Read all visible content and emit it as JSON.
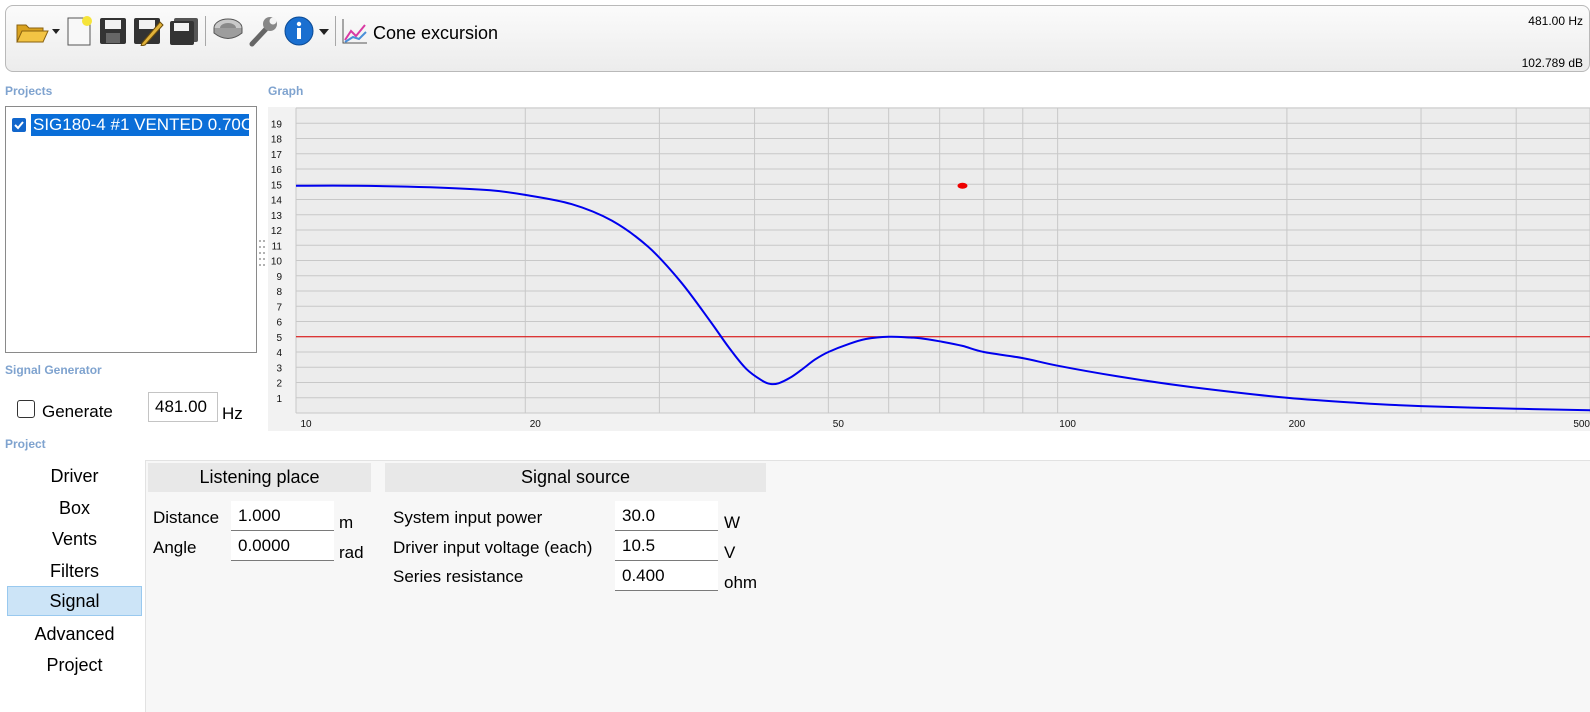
{
  "toolbar": {
    "icons": [
      "open-folder-icon",
      "new-document-icon",
      "save-icon",
      "save-edit-icon",
      "save-all-icon",
      "speaker-icon",
      "wrench-icon",
      "info-icon",
      "chart-icon"
    ],
    "graph_title": "Cone excursion"
  },
  "readout": {
    "frequency": "481.00 Hz",
    "level": "102.789 dB"
  },
  "projects": {
    "label": "Projects",
    "items": [
      {
        "name": "SIG180-4 #1 VENTED 0.70C",
        "checked": true
      }
    ]
  },
  "graph_label": "Graph",
  "signal_generator": {
    "label": "Signal Generator",
    "generate_label": "Generate",
    "frequency_value": "481.00",
    "unit": "Hz"
  },
  "project_label": "Project",
  "nav": {
    "items": [
      "Driver",
      "Box",
      "Vents",
      "Filters",
      "Signal",
      "Advanced",
      "Project"
    ],
    "active": "Signal"
  },
  "listening_place": {
    "header": "Listening place",
    "distance_label": "Distance",
    "distance_value": "1.000",
    "distance_unit": "m",
    "angle_label": "Angle",
    "angle_value": "0.0000",
    "angle_unit": "rad"
  },
  "signal_source": {
    "header": "Signal source",
    "power_label": "System input power",
    "power_value": "30.0",
    "power_unit": "W",
    "voltage_label": "Driver input voltage (each)",
    "voltage_value": "10.5",
    "voltage_unit": "V",
    "resistance_label": "Series resistance",
    "resistance_value": "0.400",
    "resistance_unit": "ohm"
  },
  "colors": {
    "curve": "#0000ee",
    "limit": "#dd0000",
    "marker": "#ee0000",
    "plot_bg": "#ececec",
    "grid": "#c8c8c8",
    "accent": "#0a6ed8"
  },
  "chart_data": {
    "type": "line",
    "x_scale": "log",
    "xlim": [
      10,
      500
    ],
    "ylim": [
      0,
      20
    ],
    "x_tick_labels": [
      "10",
      "20",
      "50",
      "100",
      "200",
      "500"
    ],
    "x_tick_values": [
      10,
      20,
      50,
      100,
      200,
      500
    ],
    "y_tick_labels": [
      "1",
      "2",
      "3",
      "4",
      "5",
      "6",
      "7",
      "8",
      "9",
      "10",
      "11",
      "12",
      "13",
      "14",
      "15",
      "16",
      "17",
      "18",
      "19"
    ],
    "y_tick_values": [
      1,
      2,
      3,
      4,
      5,
      6,
      7,
      8,
      9,
      10,
      11,
      12,
      13,
      14,
      15,
      16,
      17,
      18,
      19
    ],
    "grid": true,
    "series": [
      {
        "x": [
          10,
          12,
          15,
          18,
          20,
          23,
          26,
          29,
          32,
          35,
          37,
          39,
          41,
          42,
          43,
          44.5,
          46,
          48,
          50,
          53,
          56,
          60,
          64,
          66,
          70,
          75,
          80,
          90,
          100,
          120,
          150,
          200,
          250,
          300,
          400,
          500
        ],
        "y": [
          14.9,
          14.9,
          14.8,
          14.6,
          14.3,
          13.7,
          12.6,
          10.9,
          8.6,
          6.0,
          4.3,
          2.9,
          2.1,
          1.9,
          1.95,
          2.3,
          2.8,
          3.5,
          4.0,
          4.5,
          4.85,
          5.0,
          4.95,
          4.9,
          4.7,
          4.4,
          4.0,
          3.6,
          3.1,
          2.4,
          1.7,
          1.0,
          0.65,
          0.45,
          0.28,
          0.18
        ]
      }
    ],
    "limit_line": 5,
    "marker": {
      "x": 75,
      "y": 14.9
    }
  }
}
